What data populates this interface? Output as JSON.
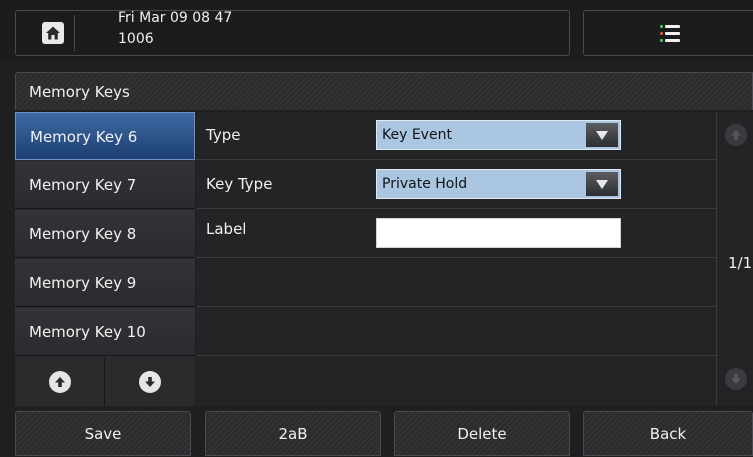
{
  "status": {
    "date_time": "Fri Mar 09 08 47",
    "extension": "1006"
  },
  "title": "Memory Keys",
  "sidebar": {
    "items": [
      {
        "label": "Memory Key 6"
      },
      {
        "label": "Memory Key 7"
      },
      {
        "label": "Memory Key 8"
      },
      {
        "label": "Memory Key 9"
      },
      {
        "label": "Memory Key 10"
      }
    ],
    "active_index": 0
  },
  "form": {
    "type": {
      "label": "Type",
      "value": "Key Event"
    },
    "key_type": {
      "label": "Key Type",
      "value": "Private Hold"
    },
    "label": {
      "label": "Label",
      "value": ""
    }
  },
  "pagination": {
    "text": "1/1"
  },
  "softkeys": [
    "Save",
    "2aB",
    "Delete",
    "Back"
  ],
  "icons": {
    "home": "home-icon",
    "menu": "menu-list-icon",
    "up": "arrow-up-icon",
    "down": "arrow-down-icon",
    "dropdown": "triangle-down-icon"
  },
  "colors": {
    "active_item": "#2d548c",
    "select_bg": "#aac6e0",
    "menu_dot_green": "#4cc64c",
    "menu_dot_red": "#e34b3b"
  }
}
